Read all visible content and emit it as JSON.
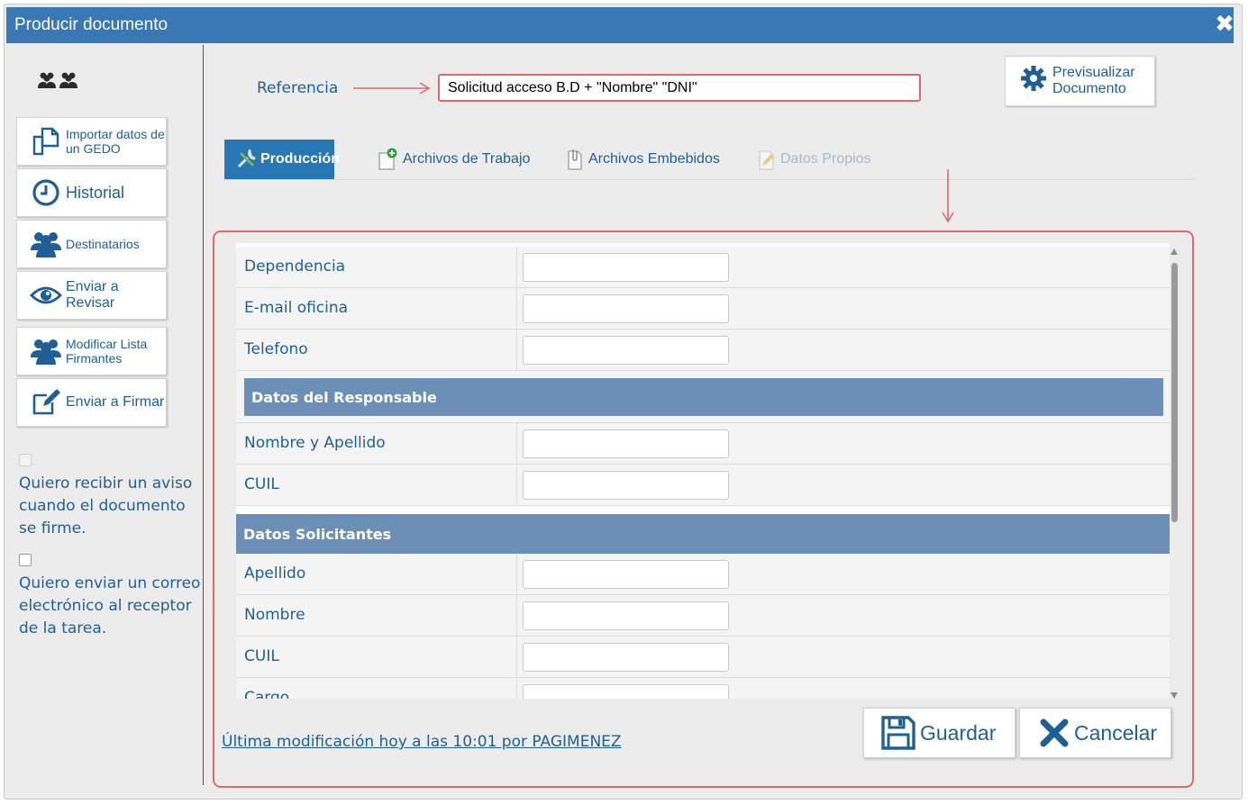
{
  "window": {
    "title": "Producir documento"
  },
  "sidebar": {
    "buttons": [
      {
        "label": "Importar datos de un GEDO",
        "icon": "copy-icon"
      },
      {
        "label": "Historial",
        "icon": "clock-icon"
      },
      {
        "label": "Destinatarios",
        "icon": "users-icon"
      },
      {
        "label": "Enviar a Revisar",
        "icon": "eye-icon"
      },
      {
        "label": "Modificar Lista Firmantes",
        "icon": "users-icon"
      },
      {
        "label": "Enviar a Firmar",
        "icon": "edit-icon"
      }
    ],
    "checkboxes": [
      {
        "label": "Quiero recibir un aviso cuando el documento se firme.",
        "checked": false,
        "disabled": true
      },
      {
        "label": "Quiero enviar un correo electrónico al receptor de la tarea.",
        "checked": false,
        "disabled": false
      }
    ]
  },
  "reference": {
    "label": "Referencia",
    "value": "Solicitud acceso B.D + \"Nombre\" \"DNI\""
  },
  "preview_button": {
    "label": "Previsualizar Documento"
  },
  "tabs": [
    {
      "label": "Producción",
      "active": true
    },
    {
      "label": "Archivos de Trabajo"
    },
    {
      "label": "Archivos Embebidos"
    },
    {
      "label": "Datos Propios",
      "disabled": true
    }
  ],
  "form": {
    "rows_top": [
      {
        "label": "Dependencia",
        "value": ""
      },
      {
        "label": "E-mail oficina",
        "value": ""
      },
      {
        "label": "Telefono",
        "value": ""
      }
    ],
    "section_responsable": "Datos del Responsable",
    "rows_responsable": [
      {
        "label": "Nombre y Apellido",
        "value": ""
      },
      {
        "label": "CUIL",
        "value": ""
      }
    ],
    "section_solicitantes": "Datos Solicitantes",
    "rows_solicitantes": [
      {
        "label": "Apellido",
        "value": ""
      },
      {
        "label": "Nombre",
        "value": ""
      },
      {
        "label": "CUIL",
        "value": ""
      },
      {
        "label": "Cargo",
        "value": ""
      }
    ]
  },
  "footer": {
    "last_modified": "Última modificación hoy a las 10:01 por PAGIMENEZ",
    "save_label": "Guardar",
    "cancel_label": "Cancelar"
  },
  "colors": {
    "titlebar": "#3a78b5",
    "accent_text": "#1f5f95",
    "active_tab": "#2677b3",
    "section_header": "#6b8fb7",
    "highlight": "#e06868"
  }
}
